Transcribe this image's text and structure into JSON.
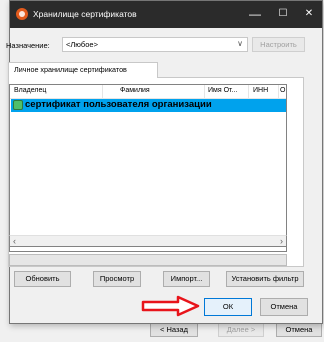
{
  "window_title": "Хранилище сертификатов",
  "titlebar": {
    "minimize": "—",
    "maximize": "☐",
    "close": "✕"
  },
  "purpose_label": "Назначение:",
  "purpose_value": "<Любое>",
  "configure_button": "Настроить",
  "tab_label": "Личное хранилище сертификатов",
  "columns": [
    "Владелец",
    "Фамилия",
    "Имя От...",
    "ИНН",
    "ОГ"
  ],
  "selected_row": "сертификат пользователя организации",
  "buttons": {
    "refresh": "Обновить",
    "view": "Просмотр",
    "import": "Импорт...",
    "filter": "Установить фильтр",
    "ok": "ОК",
    "cancel": "Отмена"
  },
  "background_buttons": {
    "back": "< Назад",
    "next": "Далее >",
    "cancel": "Отмена"
  },
  "colors": {
    "selection": "#00a2ed",
    "arrow": "#e8141b",
    "titlebar": "#2b2b2b",
    "ok_border": "#0078d7"
  }
}
